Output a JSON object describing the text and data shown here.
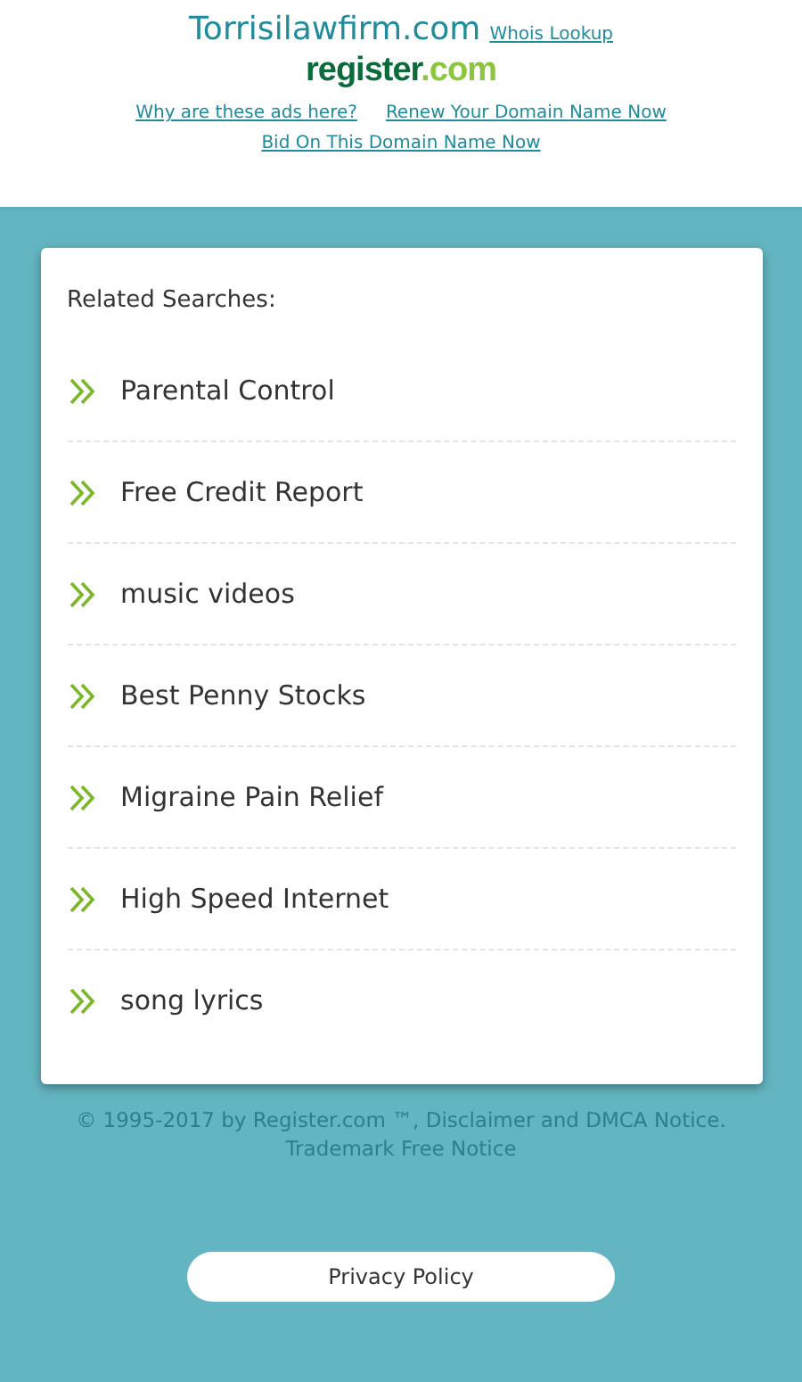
{
  "header": {
    "domain": "Torrisilawfirm.com",
    "whois_link": "Whois Lookup",
    "logo": {
      "name": "register",
      "suffix": ".com"
    },
    "links": [
      "Why are these ads here?",
      "Renew Your Domain Name Now",
      "Bid On This Domain Name Now"
    ]
  },
  "related": {
    "title": "Related Searches:",
    "items": [
      "Parental Control",
      "Free Credit Report",
      "music videos",
      "Best Penny Stocks",
      "Migraine Pain Relief",
      "High Speed Internet",
      "song lyrics"
    ]
  },
  "footer": {
    "copyright": "© 1995-2017 by Register.com ™, Disclaimer and DMCA Notice. Trademark Free Notice",
    "privacy_button": "Privacy Policy"
  }
}
